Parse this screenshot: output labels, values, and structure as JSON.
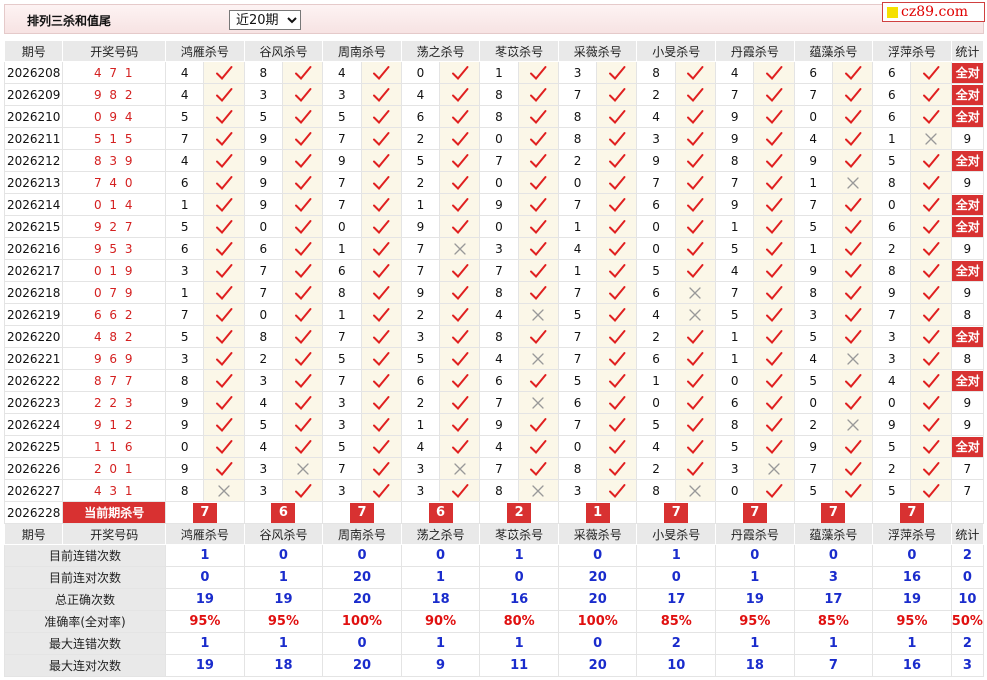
{
  "header": {
    "title": "排列三杀和值尾",
    "select": {
      "selected": "近20期",
      "options": [
        "近20期"
      ]
    },
    "logo_text": "cz89.com"
  },
  "colors": {
    "accent_red": "#d83131",
    "draw_red": "#d42020",
    "stat_blue": "#1a2ccc",
    "check_red": "#e02020",
    "cross_grey": "#999999"
  },
  "icons": {
    "hit": "check-icon",
    "miss": "cross-icon"
  },
  "table": {
    "col_period": "期号",
    "col_draw": "开奖号码",
    "experts": [
      "鸿雁杀号",
      "谷风杀号",
      "周南杀号",
      "荡之杀号",
      "苳苡杀号",
      "采薇杀号",
      "小旻杀号",
      "丹霞杀号",
      "蕴藻杀号",
      "浮萍杀号"
    ],
    "col_stat": "统计",
    "rows": [
      {
        "period": "2026208",
        "draw": "4 7 1",
        "kills": [
          4,
          8,
          4,
          0,
          1,
          3,
          8,
          4,
          6,
          6
        ],
        "hits": [
          1,
          1,
          1,
          1,
          1,
          1,
          1,
          1,
          1,
          1
        ],
        "stat": "全对"
      },
      {
        "period": "2026209",
        "draw": "9 8 2",
        "kills": [
          4,
          3,
          3,
          4,
          8,
          7,
          2,
          7,
          7,
          6
        ],
        "hits": [
          1,
          1,
          1,
          1,
          1,
          1,
          1,
          1,
          1,
          1
        ],
        "stat": "全对"
      },
      {
        "period": "2026210",
        "draw": "0 9 4",
        "kills": [
          5,
          5,
          5,
          6,
          8,
          8,
          4,
          9,
          0,
          6
        ],
        "hits": [
          1,
          1,
          1,
          1,
          1,
          1,
          1,
          1,
          1,
          1
        ],
        "stat": "全对"
      },
      {
        "period": "2026211",
        "draw": "5 1 5",
        "kills": [
          7,
          9,
          7,
          2,
          0,
          8,
          3,
          9,
          4,
          1
        ],
        "hits": [
          1,
          1,
          1,
          1,
          1,
          1,
          1,
          1,
          1,
          0
        ],
        "stat": "9"
      },
      {
        "period": "2026212",
        "draw": "8 3 9",
        "kills": [
          4,
          9,
          9,
          5,
          7,
          2,
          9,
          8,
          9,
          5
        ],
        "hits": [
          1,
          1,
          1,
          1,
          1,
          1,
          1,
          1,
          1,
          1
        ],
        "stat": "全对"
      },
      {
        "period": "2026213",
        "draw": "7 4 0",
        "kills": [
          6,
          9,
          7,
          2,
          0,
          0,
          7,
          7,
          1,
          8
        ],
        "hits": [
          1,
          1,
          1,
          1,
          1,
          1,
          1,
          1,
          0,
          1
        ],
        "stat": "9"
      },
      {
        "period": "2026214",
        "draw": "0 1 4",
        "kills": [
          1,
          9,
          7,
          1,
          9,
          7,
          6,
          9,
          7,
          0
        ],
        "hits": [
          1,
          1,
          1,
          1,
          1,
          1,
          1,
          1,
          1,
          1
        ],
        "stat": "全对"
      },
      {
        "period": "2026215",
        "draw": "9 2 7",
        "kills": [
          5,
          0,
          0,
          9,
          0,
          1,
          0,
          1,
          5,
          6
        ],
        "hits": [
          1,
          1,
          1,
          1,
          1,
          1,
          1,
          1,
          1,
          1
        ],
        "stat": "全对"
      },
      {
        "period": "2026216",
        "draw": "9 5 3",
        "kills": [
          6,
          6,
          1,
          7,
          3,
          4,
          0,
          5,
          1,
          2
        ],
        "hits": [
          1,
          1,
          1,
          0,
          1,
          1,
          1,
          1,
          1,
          1
        ],
        "stat": "9"
      },
      {
        "period": "2026217",
        "draw": "0 1 9",
        "kills": [
          3,
          7,
          6,
          7,
          7,
          1,
          5,
          4,
          9,
          8
        ],
        "hits": [
          1,
          1,
          1,
          1,
          1,
          1,
          1,
          1,
          1,
          1
        ],
        "stat": "全对"
      },
      {
        "period": "2026218",
        "draw": "0 7 9",
        "kills": [
          1,
          7,
          8,
          9,
          8,
          7,
          6,
          7,
          8,
          9
        ],
        "hits": [
          1,
          1,
          1,
          1,
          1,
          1,
          0,
          1,
          1,
          1
        ],
        "stat": "9"
      },
      {
        "period": "2026219",
        "draw": "6 6 2",
        "kills": [
          7,
          0,
          1,
          2,
          4,
          5,
          4,
          5,
          3,
          7
        ],
        "hits": [
          1,
          1,
          1,
          1,
          0,
          1,
          0,
          1,
          1,
          1
        ],
        "stat": "8"
      },
      {
        "period": "2026220",
        "draw": "4 8 2",
        "kills": [
          5,
          8,
          7,
          3,
          8,
          7,
          2,
          1,
          5,
          3
        ],
        "hits": [
          1,
          1,
          1,
          1,
          1,
          1,
          1,
          1,
          1,
          1
        ],
        "stat": "全对"
      },
      {
        "period": "2026221",
        "draw": "9 6 9",
        "kills": [
          3,
          2,
          5,
          5,
          4,
          7,
          6,
          1,
          4,
          3
        ],
        "hits": [
          1,
          1,
          1,
          1,
          0,
          1,
          1,
          1,
          0,
          1
        ],
        "stat": "8"
      },
      {
        "period": "2026222",
        "draw": "8 7 7",
        "kills": [
          8,
          3,
          7,
          6,
          6,
          5,
          1,
          0,
          5,
          4
        ],
        "hits": [
          1,
          1,
          1,
          1,
          1,
          1,
          1,
          1,
          1,
          1
        ],
        "stat": "全对"
      },
      {
        "period": "2026223",
        "draw": "2 2 3",
        "kills": [
          9,
          4,
          3,
          2,
          7,
          6,
          0,
          6,
          0,
          0
        ],
        "hits": [
          1,
          1,
          1,
          1,
          0,
          1,
          1,
          1,
          1,
          1
        ],
        "stat": "9"
      },
      {
        "period": "2026224",
        "draw": "9 1 2",
        "kills": [
          9,
          5,
          3,
          1,
          9,
          7,
          5,
          8,
          2,
          9
        ],
        "hits": [
          1,
          1,
          1,
          1,
          1,
          1,
          1,
          1,
          0,
          1
        ],
        "stat": "9"
      },
      {
        "period": "2026225",
        "draw": "1 1 6",
        "kills": [
          0,
          4,
          5,
          4,
          4,
          0,
          4,
          5,
          9,
          5
        ],
        "hits": [
          1,
          1,
          1,
          1,
          1,
          1,
          1,
          1,
          1,
          1
        ],
        "stat": "全对"
      },
      {
        "period": "2026226",
        "draw": "2 0 1",
        "kills": [
          9,
          3,
          7,
          3,
          7,
          8,
          2,
          3,
          7,
          2
        ],
        "hits": [
          1,
          0,
          1,
          0,
          1,
          1,
          1,
          0,
          1,
          1
        ],
        "stat": "7"
      },
      {
        "period": "2026227",
        "draw": "4 3 1",
        "kills": [
          8,
          3,
          3,
          3,
          8,
          3,
          8,
          0,
          5,
          5
        ],
        "hits": [
          0,
          1,
          1,
          1,
          0,
          1,
          0,
          1,
          1,
          1
        ],
        "stat": "7"
      }
    ],
    "current": {
      "period": "2026228",
      "label": "当前期杀号",
      "kills": [
        7,
        6,
        7,
        6,
        2,
        1,
        7,
        7,
        7,
        7
      ]
    }
  },
  "summary": {
    "rows": [
      {
        "label": "目前连错次数",
        "values": [
          "1",
          "0",
          "0",
          "0",
          "1",
          "0",
          "1",
          "0",
          "0",
          "0",
          "2"
        ],
        "red": false
      },
      {
        "label": "目前连对次数",
        "values": [
          "0",
          "1",
          "20",
          "1",
          "0",
          "20",
          "0",
          "1",
          "3",
          "16",
          "0"
        ],
        "red": false
      },
      {
        "label": "总正确次数",
        "values": [
          "19",
          "19",
          "20",
          "18",
          "16",
          "20",
          "17",
          "19",
          "17",
          "19",
          "10"
        ],
        "red": false
      },
      {
        "label": "准确率(全对率)",
        "values": [
          "95%",
          "95%",
          "100%",
          "90%",
          "80%",
          "100%",
          "85%",
          "95%",
          "85%",
          "95%",
          "50%"
        ],
        "red": true
      },
      {
        "label": "最大连错次数",
        "values": [
          "1",
          "1",
          "0",
          "1",
          "1",
          "0",
          "2",
          "1",
          "1",
          "1",
          "2"
        ],
        "red": false
      },
      {
        "label": "最大连对次数",
        "values": [
          "19",
          "18",
          "20",
          "9",
          "11",
          "20",
          "10",
          "18",
          "7",
          "16",
          "3"
        ],
        "red": false
      }
    ]
  }
}
